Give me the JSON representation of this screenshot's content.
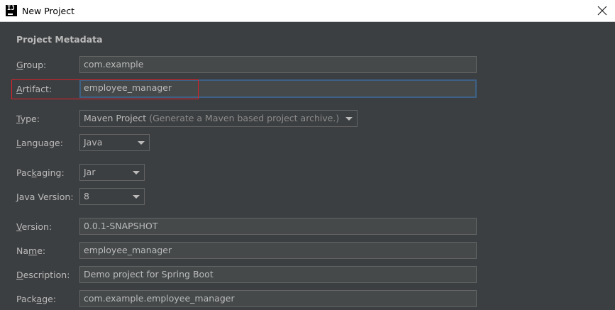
{
  "window": {
    "title": "New Project",
    "app_icon_text": "IJ"
  },
  "section": {
    "title": "Project Metadata"
  },
  "fields": {
    "group": {
      "label_key": "G",
      "label_rest": "roup:",
      "value": "com.example"
    },
    "artifact": {
      "label_key": "A",
      "label_rest": "rtifact:",
      "value": "employee_manager"
    },
    "type": {
      "label_key": "T",
      "label_rest": "ype:",
      "value": "Maven Project",
      "hint": "(Generate a Maven based project archive.)"
    },
    "language": {
      "label_key": "L",
      "label_rest": "anguage:",
      "value": "Java"
    },
    "packaging": {
      "label_pre": "Pac",
      "label_key": "k",
      "label_rest": "aging:",
      "value": "Jar"
    },
    "java_version": {
      "label_key": "J",
      "label_rest": "ava Version:",
      "value": "8"
    },
    "version": {
      "label_key": "V",
      "label_rest": "ersion:",
      "value": "0.0.1-SNAPSHOT"
    },
    "name": {
      "label_pre": "Na",
      "label_key": "m",
      "label_rest": "e:",
      "value": "employee_manager"
    },
    "description": {
      "label_key": "D",
      "label_rest": "escription:",
      "value": "Demo project for Spring Boot"
    },
    "package": {
      "label_pre": "Pack",
      "label_key": "a",
      "label_rest": "ge:",
      "value": "com.example.employee_manager"
    }
  },
  "colors": {
    "background": "#3c3f41",
    "field_bg": "#45494a",
    "focus_border": "#3d6185",
    "annotation": "#e0202a"
  }
}
